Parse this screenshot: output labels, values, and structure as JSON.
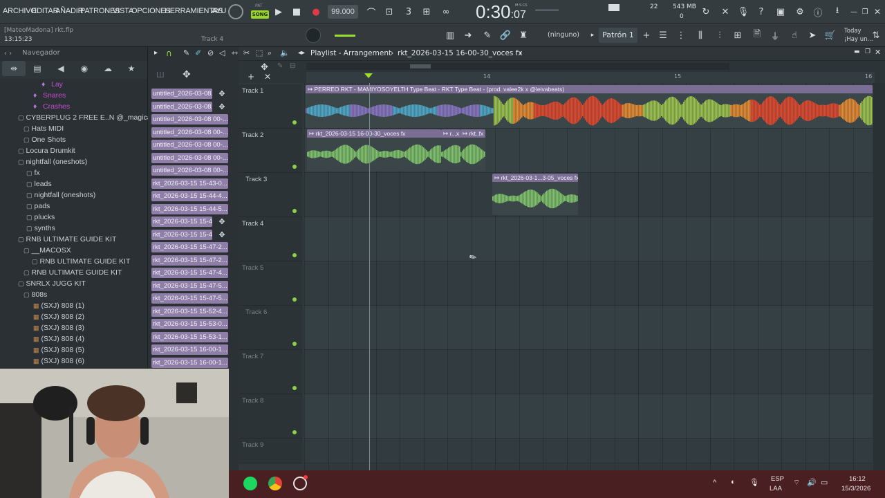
{
  "menu": [
    "ARCHIVO",
    "EDITAR",
    "AÑADIR",
    "PATRONES",
    "VISTA",
    "OPCIONES",
    "HERRAMIENTAS",
    "AYU"
  ],
  "transport": {
    "song_badge": "SONG",
    "pat_label": "PAT",
    "tempo": "99.000",
    "time_main": "0:30",
    "time_sub": ":07",
    "time_unit": "M:S:CS",
    "cpu_value": "22",
    "memory": "543 MB",
    "voices": "0"
  },
  "project": {
    "user_file": "[MateoMadona] rkt.flp",
    "time": "13:15:23",
    "hint_track": "Track 4",
    "preset": "(ninguno)",
    "pattern": "Patrón 1",
    "news_title": "Today",
    "news_sub": "¡Hay un..."
  },
  "browser": {
    "title": "Navegador",
    "items": [
      {
        "label": "Lay",
        "kind": "pink",
        "indent": 60
      },
      {
        "label": "Snares",
        "kind": "pink",
        "indent": 48
      },
      {
        "label": "Crashes",
        "kind": "pink",
        "indent": 48
      },
      {
        "label": "CYBERPLUG 2 FREE E..N @_magicalsounds",
        "kind": "folder",
        "indent": 26
      },
      {
        "label": "Hats MIDI",
        "kind": "folder",
        "indent": 34
      },
      {
        "label": "One Shots",
        "kind": "folder",
        "indent": 34
      },
      {
        "label": "Locura Drumkit",
        "kind": "folder",
        "indent": 26
      },
      {
        "label": "nightfall (oneshots)",
        "kind": "folder",
        "indent": 26
      },
      {
        "label": "fx",
        "kind": "folder",
        "indent": 38
      },
      {
        "label": "leads",
        "kind": "folder",
        "indent": 38
      },
      {
        "label": "nightfall (oneshots)",
        "kind": "folder",
        "indent": 38
      },
      {
        "label": "pads",
        "kind": "folder",
        "indent": 38
      },
      {
        "label": "plucks",
        "kind": "folder",
        "indent": 38
      },
      {
        "label": "synths",
        "kind": "folder",
        "indent": 38
      },
      {
        "label": "RNB ULTIMATE GUIDE KIT",
        "kind": "folder",
        "indent": 26
      },
      {
        "label": "__MACOSX",
        "kind": "folder",
        "indent": 34
      },
      {
        "label": "RNB ULTIMATE GUIDE KIT",
        "kind": "folder",
        "indent": 46
      },
      {
        "label": "RNB ULTIMATE GUIDE KIT",
        "kind": "folder",
        "indent": 34
      },
      {
        "label": "SNRLX JUGG KIT",
        "kind": "folder",
        "indent": 26
      },
      {
        "label": "808s",
        "kind": "folder",
        "indent": 34
      },
      {
        "label": "(SXJ) 808 (1)",
        "kind": "sxj",
        "indent": 48
      },
      {
        "label": "(SXJ) 808 (2)",
        "kind": "sxj",
        "indent": 48
      },
      {
        "label": "(SXJ) 808 (3)",
        "kind": "sxj",
        "indent": 48
      },
      {
        "label": "(SXJ) 808 (4)",
        "kind": "sxj",
        "indent": 48
      },
      {
        "label": "(SXJ) 808 (5)",
        "kind": "sxj",
        "indent": 48
      },
      {
        "label": "(SXJ) 808 (6)",
        "kind": "sxj",
        "indent": 48
      }
    ]
  },
  "clips": [
    {
      "label": "untitled_2026-03-08...",
      "plus": true
    },
    {
      "label": "untitled_2026-03-08...",
      "plus": true
    },
    {
      "label": "untitled_2026-03-08 00-...",
      "plus": false
    },
    {
      "label": "untitled_2026-03-08 00-...",
      "plus": false
    },
    {
      "label": "untitled_2026-03-08 00-...",
      "plus": false
    },
    {
      "label": "untitled_2026-03-08 00-...",
      "plus": false
    },
    {
      "label": "untitled_2026-03-08 00-...",
      "plus": false
    },
    {
      "label": "rkt_2026-03-15 15-43-0...",
      "plus": false
    },
    {
      "label": "rkt_2026-03-15 15-44-4...",
      "plus": false
    },
    {
      "label": "rkt_2026-03-15 15-44-5...",
      "plus": false
    },
    {
      "label": "rkt_2026-03-15 15-4...",
      "plus": true
    },
    {
      "label": "rkt_2026-03-15 15-4...",
      "plus": true
    },
    {
      "label": "rkt_2026-03-15 15-47-2...",
      "plus": false
    },
    {
      "label": "rkt_2026-03-15 15-47-2...",
      "plus": false
    },
    {
      "label": "rkt_2026-03-15 15-47-4...",
      "plus": false
    },
    {
      "label": "rkt_2026-03-15 15-47-5...",
      "plus": false
    },
    {
      "label": "rkt_2026-03-15 15-47-5...",
      "plus": false
    },
    {
      "label": "rkt_2026-03-15 15-52-4...",
      "plus": false
    },
    {
      "label": "rkt_2026-03-15 15-53-0...",
      "plus": false
    },
    {
      "label": "rkt_2026-03-15 15-53-1...",
      "plus": false
    },
    {
      "label": "rkt_2026-03-15 16-00-1...",
      "plus": false
    },
    {
      "label": "rkt_2026-03-15 16-00-1...",
      "plus": false
    }
  ],
  "playlist": {
    "title": "Playlist - Arrangement",
    "breadcrumb": "rkt_2026-03-15 16-00-30_voces fx",
    "bar_numbers": [
      "14",
      "15",
      "16"
    ],
    "tracks": [
      "Track 1",
      "Track 2",
      "Track 3",
      "Track 4",
      "Track 5",
      "Track 6",
      "Track 7",
      "Track 8",
      "Track 9"
    ],
    "patterns": [
      {
        "track": 1,
        "label": "PERREO RKT - MAMIYOSOYELTH Type Beat - RKT Type Beat - (prod. valee2k x @leivabeats)"
      },
      {
        "track": 2,
        "label": "rkt_2026-03-15 16-00-30_voces fx"
      },
      {
        "track": 2,
        "label": "r...x"
      },
      {
        "track": 2,
        "label": "rkt..fx"
      },
      {
        "track": 3,
        "label": "rkt_2026-03-1...3-05_voces fx"
      }
    ]
  },
  "taskbar": {
    "lang_top": "ESP",
    "lang_bottom": "LAA",
    "clock_time": "16:12",
    "clock_date": "15/3/2026"
  }
}
